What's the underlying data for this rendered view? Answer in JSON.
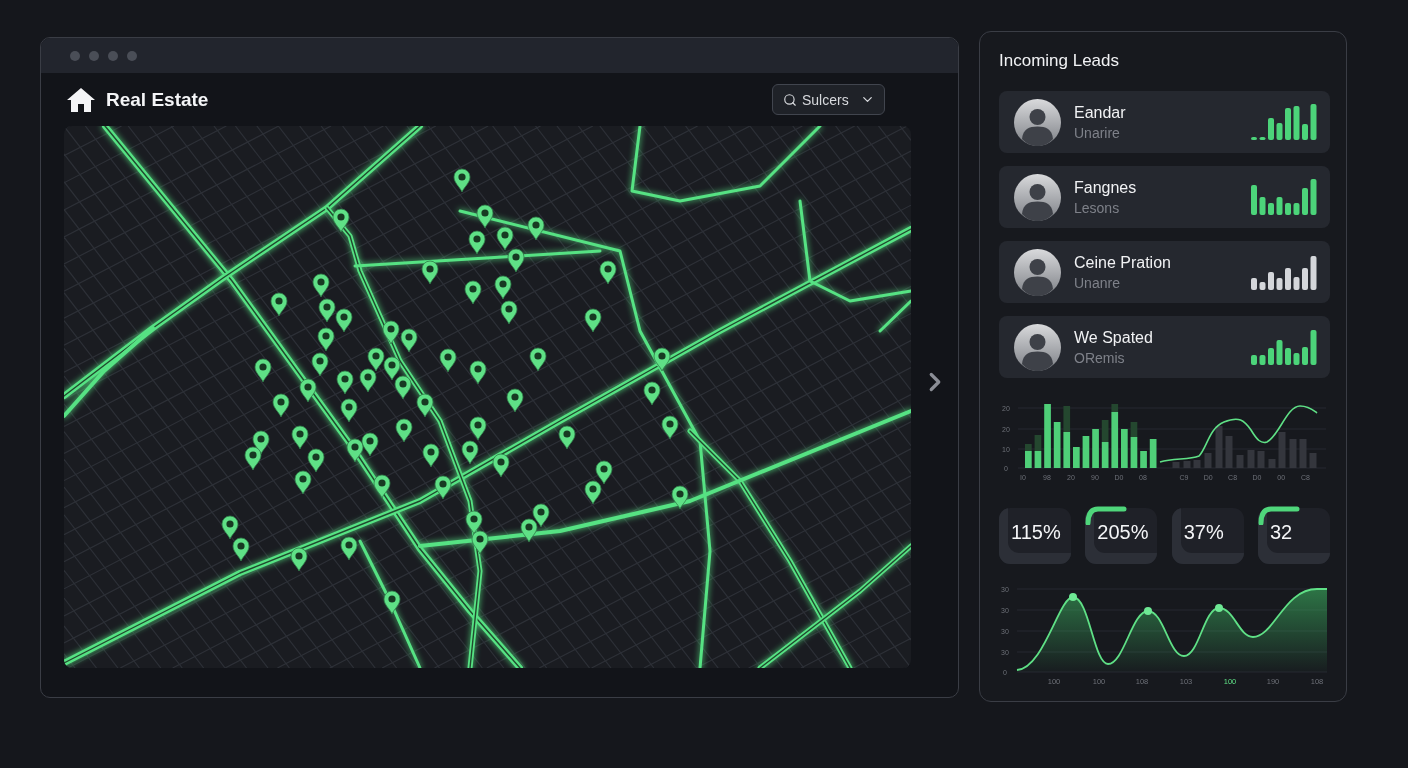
{
  "header": {
    "title": "Real Estate",
    "dropdown": {
      "label": "Sulcers"
    }
  },
  "leads_panel": {
    "title": "Incoming Leads",
    "leads": [
      {
        "name": "Eandar",
        "subtitle": "Unarire",
        "color": "#4cd47a"
      },
      {
        "name": "Fangnes",
        "subtitle": "Lesons",
        "color": "#4cd47a"
      },
      {
        "name": "Ceine Pration",
        "subtitle": "Unanre",
        "color": "#d4d6da"
      },
      {
        "name": "We Spated",
        "subtitle": "ORemis",
        "color": "#4cd47a"
      }
    ]
  },
  "bar_chart": {
    "y_labels": [
      "20",
      "20",
      "10",
      "0"
    ],
    "x_labels": [
      "I0",
      "98",
      "20",
      "90",
      "D0",
      "08",
      "C9",
      "D0",
      "C8",
      "D0",
      "00",
      "C8"
    ]
  },
  "stats": [
    {
      "value": "115%",
      "highlighted": false
    },
    {
      "value": "205%",
      "highlighted": true
    },
    {
      "value": "37%",
      "highlighted": false
    },
    {
      "value": "32",
      "highlighted": true
    }
  ],
  "area_chart": {
    "y_labels": [
      "30",
      "30",
      "30",
      "30",
      "0"
    ],
    "x_labels": [
      {
        "text": "100",
        "highlighted": false
      },
      {
        "text": "100",
        "highlighted": false
      },
      {
        "text": "108",
        "highlighted": false
      },
      {
        "text": "103",
        "highlighted": false
      },
      {
        "text": "100",
        "highlighted": true
      },
      {
        "text": "190",
        "highlighted": false
      },
      {
        "text": "108",
        "highlighted": false
      }
    ]
  }
}
